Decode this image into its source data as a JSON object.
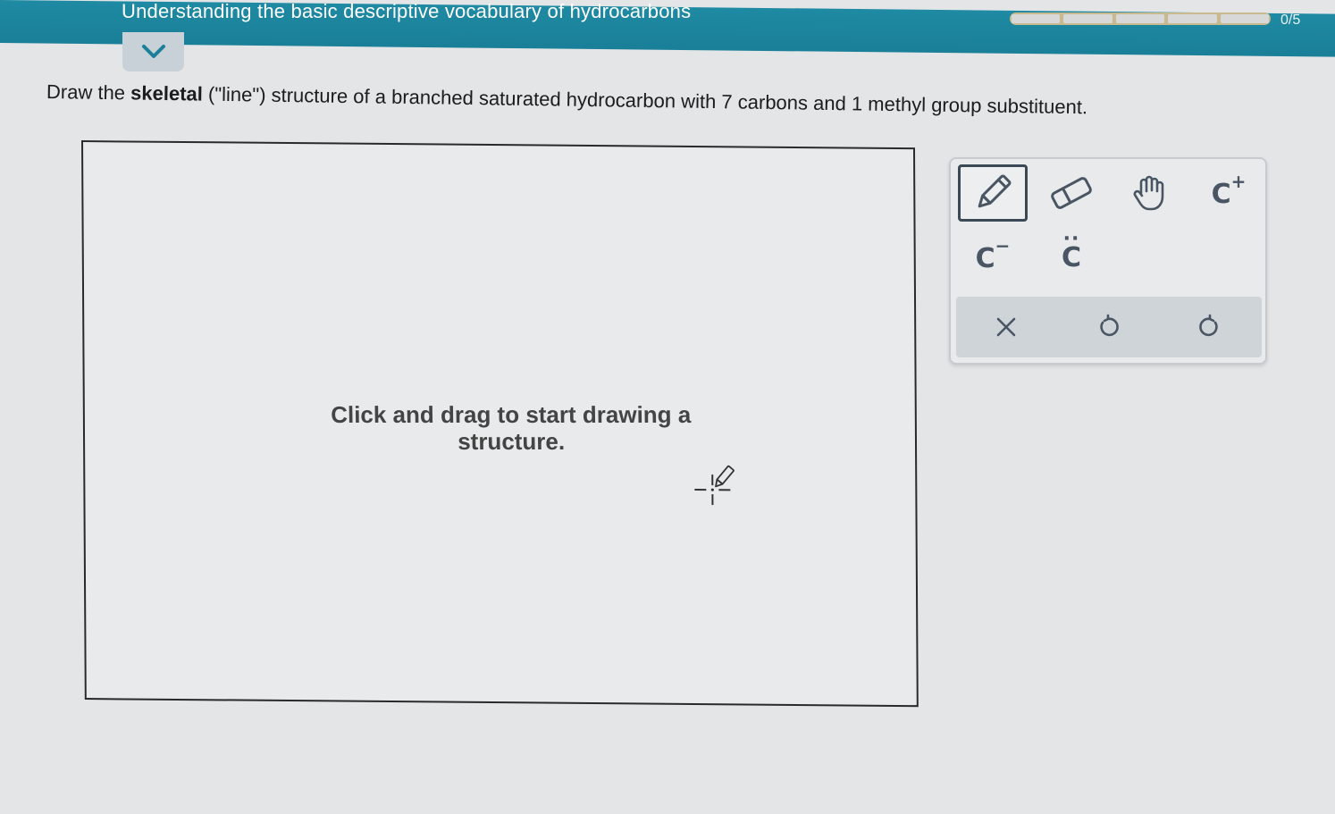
{
  "header": {
    "topic_title": "Understanding the basic descriptive vocabulary of hydrocarbons",
    "progress_text": "0/5",
    "progress_fraction": 0,
    "progress_segments": 5
  },
  "question": {
    "prefix": "Draw the ",
    "bold": "skeletal",
    "suffix": " (\"line\") structure of a branched saturated hydrocarbon with 7 carbons and 1 methyl group substituent."
  },
  "canvas": {
    "hint": "Click and drag to start drawing a structure."
  },
  "toolbox": {
    "tools": [
      {
        "name": "pencil-tool",
        "icon": "pencil-icon",
        "selected": true
      },
      {
        "name": "eraser-tool",
        "icon": "eraser-icon",
        "selected": false
      },
      {
        "name": "hand-tool",
        "icon": "hand-icon",
        "selected": false
      },
      {
        "name": "carbocation-tool",
        "label": "C",
        "mark": "+"
      },
      {
        "name": "carbanion-tool",
        "label": "C",
        "mark": "−"
      },
      {
        "name": "carbene-tool",
        "label": "C",
        "mark": "··"
      }
    ],
    "actions": [
      {
        "name": "clear-button",
        "icon": "close-icon"
      },
      {
        "name": "undo-button",
        "icon": "undo-icon"
      },
      {
        "name": "redo-button",
        "icon": "redo-icon"
      }
    ]
  },
  "colors": {
    "header_bg": "#1f8aa3",
    "canvas_bg": "#e8eaec",
    "icon_color": "#4a5563"
  }
}
